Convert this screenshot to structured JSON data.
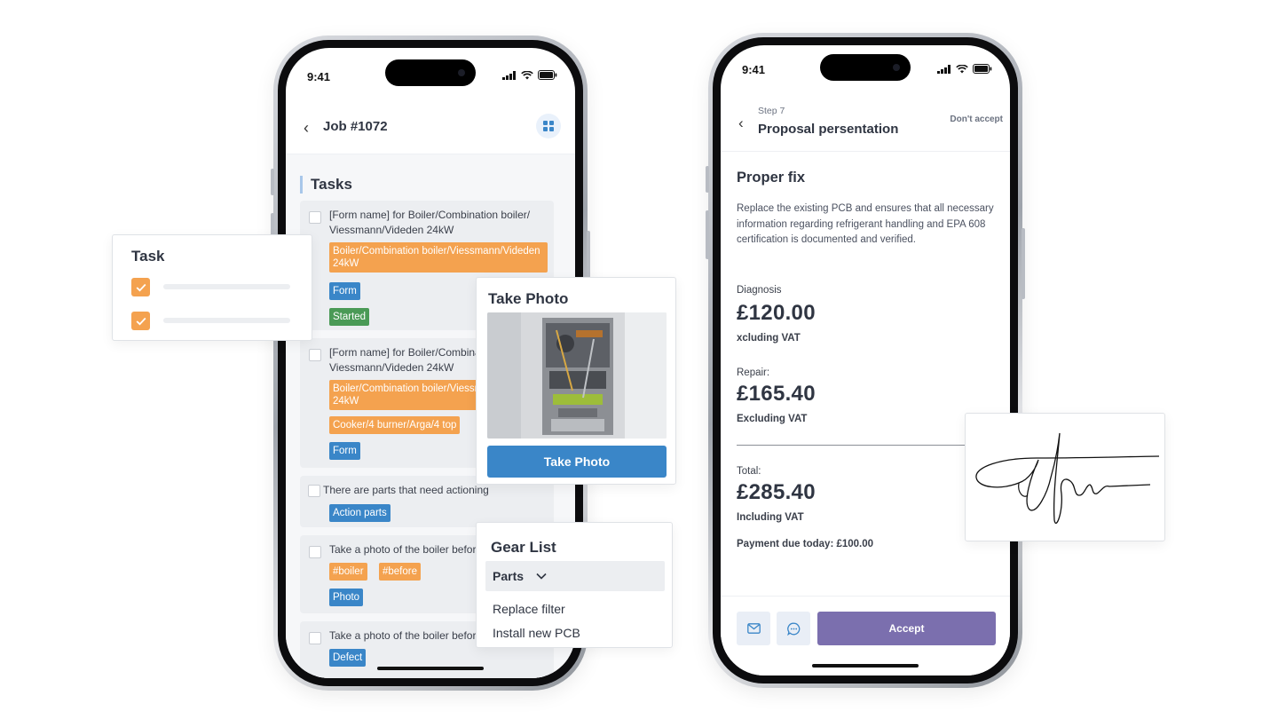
{
  "left_phone": {
    "status_time": "9:41",
    "header": {
      "title": "Job #1072"
    },
    "section_title": "Tasks",
    "tasks": [
      {
        "text": "[Form name] for Boiler/Combination boiler/ Viessmann/Videden 24kW",
        "tags": [
          {
            "label": "Boiler/Combination boiler/Viessmann/Videden 24kW",
            "color": "orange"
          },
          {
            "label": "Form",
            "color": "blue"
          },
          {
            "label": "Started",
            "color": "green"
          }
        ]
      },
      {
        "text": "[Form name] for Boiler/Combination boiler/ Viessmann/Videden 24kW",
        "tags": [
          {
            "label": "Boiler/Combination boiler/Viessmann/Videden 24kW",
            "color": "orange"
          },
          {
            "label": "Cooker/4 burner/Arga/4 top",
            "color": "orange"
          },
          {
            "label": "Form",
            "color": "blue"
          }
        ]
      },
      {
        "text": "There are parts that need actioning",
        "tags": [
          {
            "label": "Action parts",
            "color": "blue"
          }
        ]
      },
      {
        "text": "Take a photo of the boiler before",
        "tags": [
          {
            "label": "#boiler",
            "color": "orange"
          },
          {
            "label": "#before",
            "color": "orange"
          },
          {
            "label": "Photo",
            "color": "blue"
          }
        ]
      },
      {
        "text": "Take a photo of the boiler before",
        "tags": [
          {
            "label": "Defect",
            "color": "blue"
          }
        ]
      }
    ]
  },
  "task_card": {
    "title": "Task",
    "checked_count": 2
  },
  "photo_card": {
    "title": "Take Photo",
    "button_label": "Take Photo"
  },
  "gear_card": {
    "title": "Gear List",
    "dropdown_label": "Parts",
    "items": [
      "Replace filter",
      "Install new PCB"
    ]
  },
  "right_phone": {
    "status_time": "9:41",
    "header": {
      "step_label": "Step 7",
      "title": "Proposal persentation",
      "dont_accept_label": "Don't accept"
    },
    "proposal": {
      "title": "Proper fix",
      "description": "Replace the existing PCB and ensures that all necessary information regarding refrigerant handling and EPA 608 certification is documented and verified.",
      "diagnosis": {
        "label": "Diagnosis",
        "amount": "£120.00",
        "vat_note": "xcluding VAT"
      },
      "repair": {
        "label": "Repair:",
        "amount": "£165.40",
        "vat_note": "Excluding VAT"
      },
      "total": {
        "label": "Total:",
        "amount": "£285.40",
        "vat_note": "Including VAT"
      },
      "payment_due": "Payment due today: £100.00"
    },
    "footer": {
      "accept_label": "Accept"
    }
  },
  "colors": {
    "orange": "#f4a24f",
    "blue": "#3a86c8",
    "green": "#4a9a56",
    "accept": "#7b6fae"
  },
  "icons": [
    "chevron-left-icon",
    "grid-icon",
    "checkbox-icon",
    "check-icon",
    "chevron-down-icon",
    "mail-icon",
    "chat-icon",
    "signal-icon",
    "wifi-icon",
    "battery-icon"
  ]
}
